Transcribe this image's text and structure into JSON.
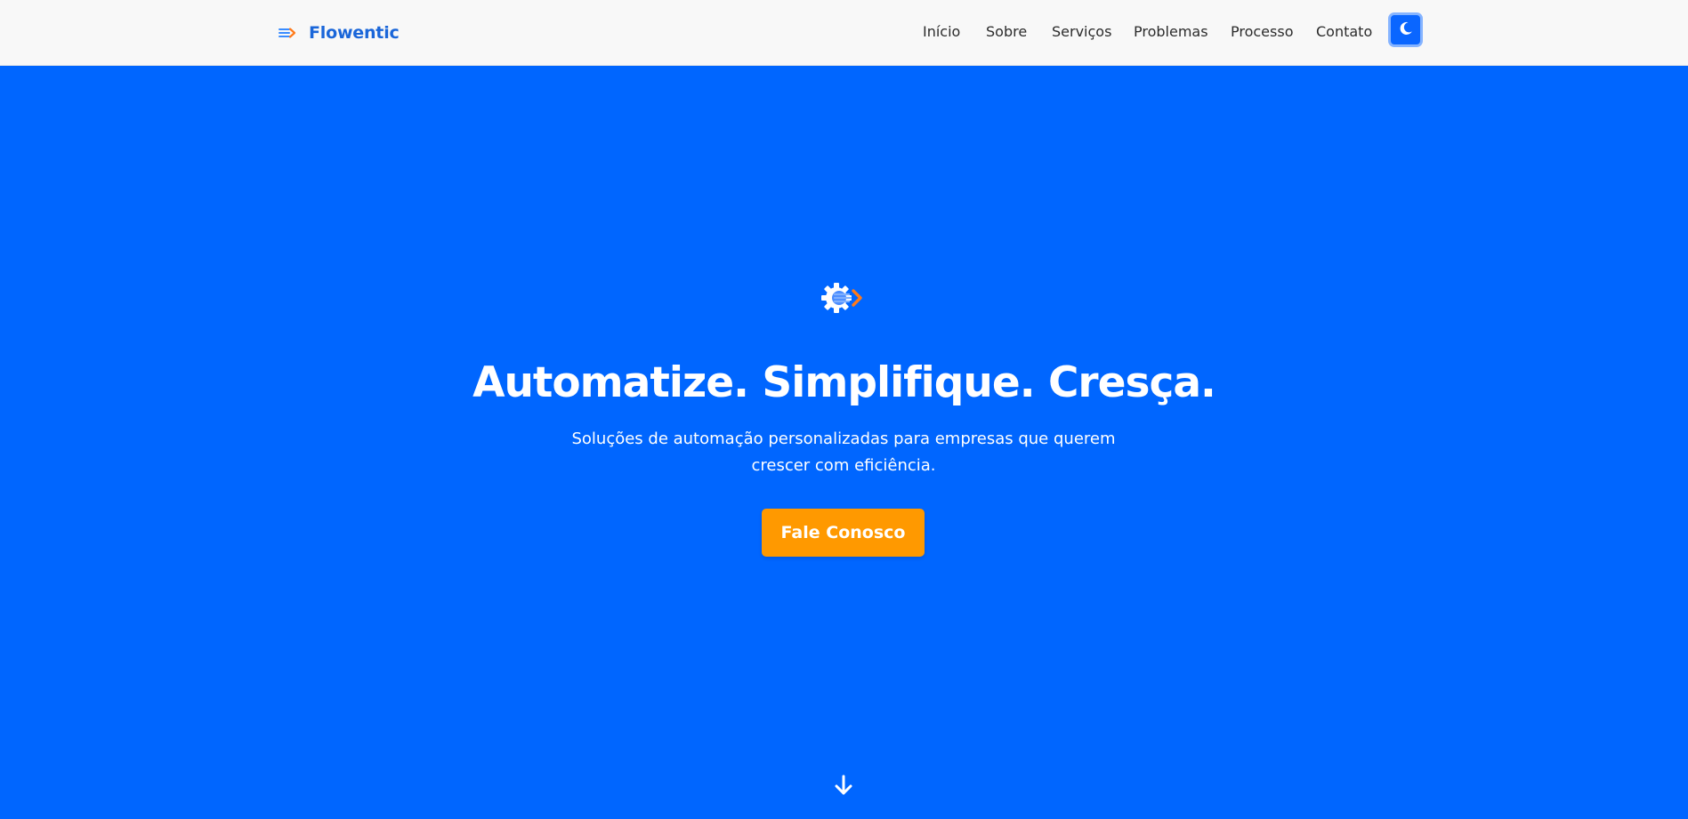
{
  "header": {
    "brand": {
      "name": "Flowentic",
      "icon": "flow-arrow-icon",
      "color": "#1a66d9"
    },
    "nav": [
      {
        "label": "Início"
      },
      {
        "label": "Sobre"
      },
      {
        "label": "Serviços"
      },
      {
        "label": "Problemas"
      },
      {
        "label": "Processo"
      },
      {
        "label": "Contato"
      }
    ],
    "theme_toggle": {
      "icon": "moon-icon",
      "color": "#0a66ff"
    }
  },
  "hero": {
    "background": "#0066ff",
    "logo_icon": "gear-flow-icon",
    "title": "Automatize. Simplifique. Cresça.",
    "subtitle_line1": "Soluções de automação personalizadas para empresas que querem",
    "subtitle_line2": "crescer com eficiência.",
    "cta_label": "Fale Conosco",
    "cta_color": "#ff9900",
    "scroll_icon": "arrow-down-icon"
  }
}
